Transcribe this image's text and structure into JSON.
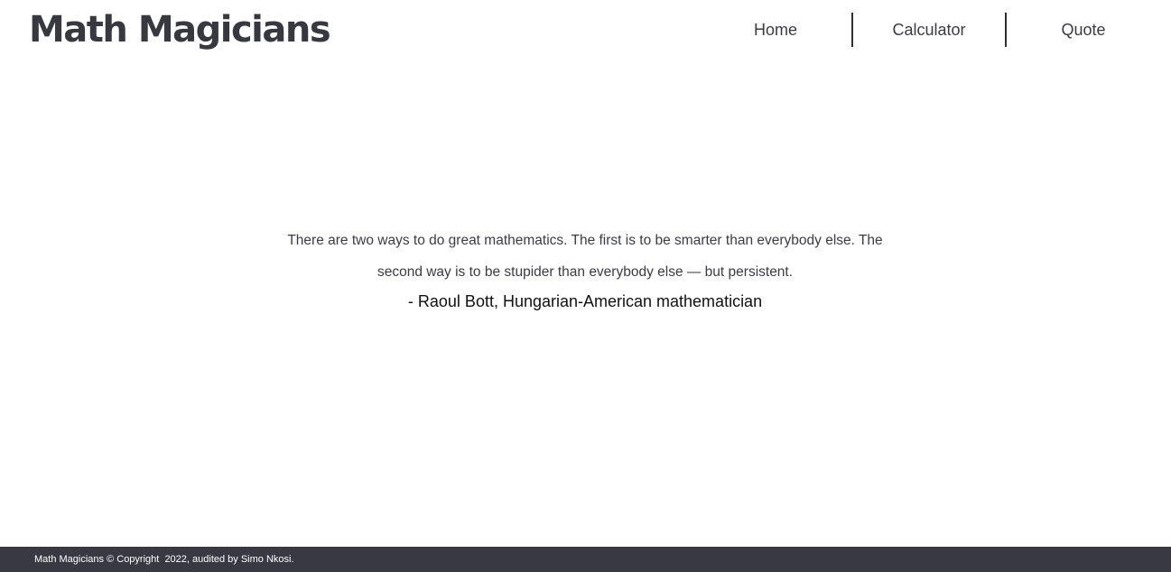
{
  "header": {
    "logo": "Math Magicians",
    "nav": [
      {
        "label": "Home"
      },
      {
        "label": "Calculator"
      },
      {
        "label": "Quote"
      }
    ]
  },
  "quote": {
    "text": "There are two ways to do great mathematics. The first is to be smarter than everybody else. The second way is to be stupider than everybody else — but persistent.",
    "author": "- Raoul Bott, Hungarian-American mathematician"
  },
  "footer": {
    "text": "Math Magicians © Copyright  2022, audited by Simo Nkosi."
  },
  "colors": {
    "text": "#3b3b45",
    "footer_bg": "#393943",
    "footer_text": "#ffffff"
  }
}
